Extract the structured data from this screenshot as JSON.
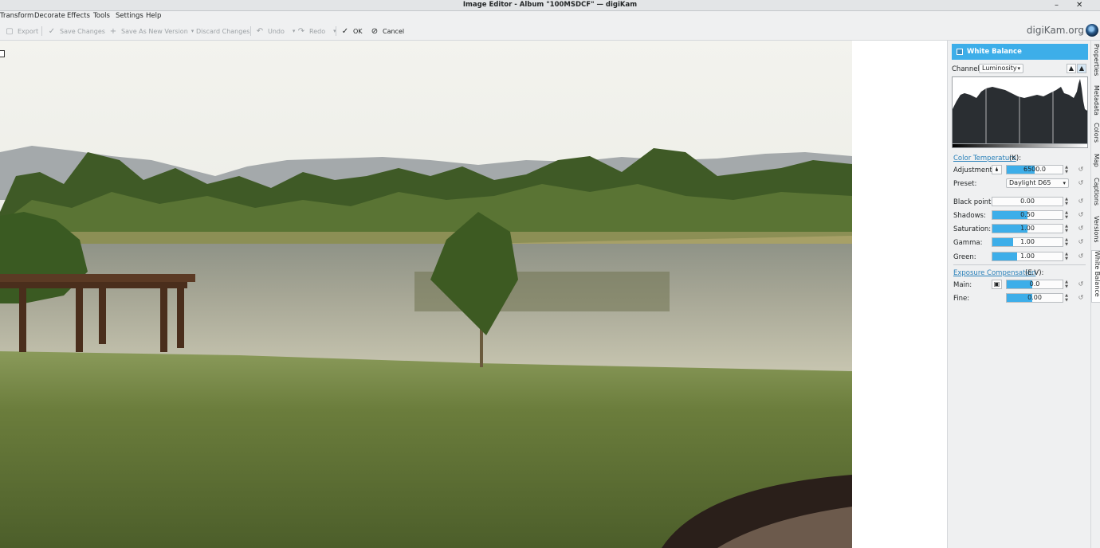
{
  "window": {
    "title": "Image Editor - Album \"100MSDCF\" — digiKam",
    "minimize": "–",
    "close": "✕"
  },
  "menu": [
    "Transform",
    "Decorate",
    "Effects",
    "Tools",
    "Settings",
    "Help"
  ],
  "toolbar": {
    "export": "Export",
    "save_changes": "Save Changes",
    "save_as_new_version": "Save As New Version",
    "discard_changes": "Discard Changes",
    "undo": "Undo",
    "redo": "Redo",
    "ok": "OK",
    "cancel": "Cancel",
    "brand": "digiKam.org"
  },
  "tool": {
    "title": "White Balance",
    "channel_label": "Channel:",
    "channel_value": "Luminosity",
    "color_temperature_link": "Color Temperature",
    "color_temperature_unit": "(K):",
    "adjustment_label": "Adjustment:",
    "adjustment_value": "6500.0",
    "adjustment_fill": 0.5,
    "preset_label": "Preset:",
    "preset_value": "Daylight D65",
    "black_point_label": "Black point:",
    "black_point_value": "0.00",
    "black_point_fill": 0.0,
    "shadows_label": "Shadows:",
    "shadows_value": "0.50",
    "shadows_fill": 0.5,
    "saturation_label": "Saturation:",
    "saturation_value": "1.00",
    "saturation_fill": 0.5,
    "gamma_label": "Gamma:",
    "gamma_value": "1.00",
    "gamma_fill": 0.3,
    "green_label": "Green:",
    "green_value": "1.00",
    "green_fill": 0.35,
    "exposure_link": "Exposure Compensation",
    "exposure_unit": "(E.V):",
    "main_label": "Main:",
    "main_value": "0.0",
    "main_fill": 0.45,
    "fine_label": "Fine:",
    "fine_value": "0.00",
    "fine_fill": 0.45
  },
  "sidebar_tabs": [
    "Properties",
    "Metadata",
    "Colors",
    "Map",
    "Captions",
    "Versions",
    "White Balance"
  ],
  "colors": {
    "accent": "#3daee9",
    "window_bg": "#eff0f1",
    "histogram_fill": "#2a2e32"
  }
}
